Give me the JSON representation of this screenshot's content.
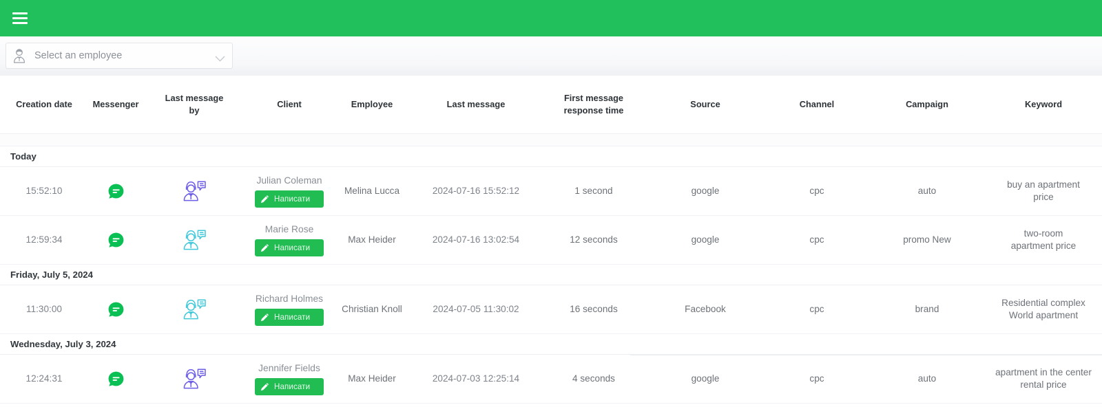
{
  "appbar": {
    "menu_icon": "hamburger-menu-icon",
    "background": "#22c05c"
  },
  "filter": {
    "employee_select": {
      "placeholder": "Select an employee",
      "value": "",
      "avatar_icon": "employee-avatar-icon",
      "chevron_icon": "chevron-down-icon"
    }
  },
  "table": {
    "columns": [
      {
        "key": "creation_date",
        "label": "Creation date"
      },
      {
        "key": "messenger",
        "label": "Messenger"
      },
      {
        "key": "last_message_by",
        "label": "Last message\nby"
      },
      {
        "key": "client",
        "label": "Client"
      },
      {
        "key": "employee",
        "label": "Employee"
      },
      {
        "key": "last_message",
        "label": "Last message"
      },
      {
        "key": "first_message_response_time",
        "label": "First message\nresponse time"
      },
      {
        "key": "source",
        "label": "Source"
      },
      {
        "key": "channel",
        "label": "Channel"
      },
      {
        "key": "campaign",
        "label": "Campaign"
      },
      {
        "key": "keyword",
        "label": "Keyword"
      }
    ],
    "column_labels": {
      "creation_date": "Creation date",
      "messenger": "Messenger",
      "last_message_by_l1": "Last message",
      "last_message_by_l2": "by",
      "client": "Client",
      "employee": "Employee",
      "last_message": "Last message",
      "first_response_l1": "First message",
      "first_response_l2": "response time",
      "source": "Source",
      "channel": "Channel",
      "campaign": "Campaign",
      "keyword": "Keyword"
    },
    "write_button_label": "Написати",
    "groups": [
      {
        "label": "Today",
        "rows": [
          {
            "creation_date": "15:52:10",
            "messenger_icon": "green-chat-bubble-icon",
            "last_message_by_icon": "operator-headset-speech-icon",
            "last_message_by_color": "#6b5ce7",
            "client": "Julian Coleman",
            "employee": "Melina Lucca",
            "last_message": "2024-07-16 15:52:12",
            "first_message_response_time": "1 second",
            "source": "google",
            "channel": "cpc",
            "campaign": "auto",
            "keyword_l1": "buy an apartment",
            "keyword_l2": "price"
          },
          {
            "creation_date": "12:59:34",
            "messenger_icon": "green-chat-bubble-icon",
            "last_message_by_icon": "client-person-speech-icon",
            "last_message_by_color": "#3fc8da",
            "client": "Marie Rose",
            "employee": "Max Heider",
            "last_message": "2024-07-16 13:02:54",
            "first_message_response_time": "12 seconds",
            "source": "google",
            "channel": "cpc",
            "campaign": "promo New",
            "keyword_l1": "two-room",
            "keyword_l2": "apartment price"
          }
        ]
      },
      {
        "label": "Friday, July 5, 2024",
        "rows": [
          {
            "creation_date": "11:30:00",
            "messenger_icon": "green-chat-bubble-icon",
            "last_message_by_icon": "client-person-speech-icon",
            "last_message_by_color": "#3fc8da",
            "client": "Richard Holmes",
            "employee": "Christian Knoll",
            "last_message": "2024-07-05 11:30:02",
            "first_message_response_time": "16 seconds",
            "source": "Facebook",
            "channel": "cpc",
            "campaign": "brand",
            "keyword_l1": "Residential complex",
            "keyword_l2": "World apartment"
          }
        ]
      },
      {
        "label": "Wednesday, July 3, 2024",
        "rows": [
          {
            "creation_date": "12:24:31",
            "messenger_icon": "green-chat-bubble-icon",
            "last_message_by_icon": "operator-headset-speech-icon",
            "last_message_by_color": "#6b5ce7",
            "client": "Jennifer Fields",
            "employee": "Max Heider",
            "last_message": "2024-07-03 12:25:14",
            "first_message_response_time": "4 seconds",
            "source": "google",
            "channel": "cpc",
            "campaign": "auto",
            "keyword_l1": "apartment in the center",
            "keyword_l2": "rental price"
          }
        ]
      }
    ]
  },
  "colors": {
    "brand_green": "#22c05c",
    "button_green": "#21bd52",
    "operator_violet": "#6b5ce7",
    "client_cyan": "#3fc8da"
  }
}
